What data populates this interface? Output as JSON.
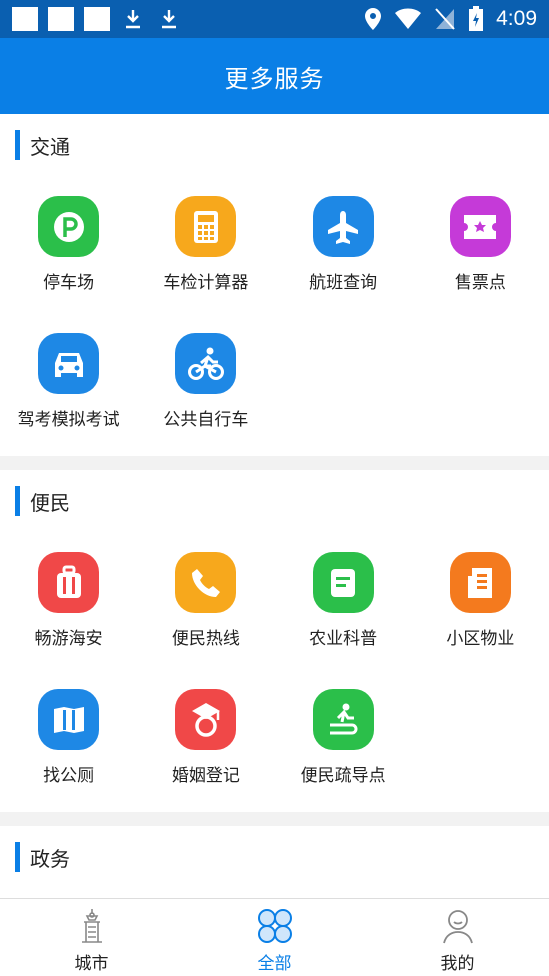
{
  "status_bar": {
    "time": "4:09"
  },
  "header": {
    "title": "更多服务"
  },
  "sections": [
    {
      "title": "交通",
      "items": [
        {
          "label": "停车场",
          "icon": "parking-icon",
          "color": "#2bbf4a"
        },
        {
          "label": "车检计算器",
          "icon": "calculator-icon",
          "color": "#f7a81c"
        },
        {
          "label": "航班查询",
          "icon": "airplane-icon",
          "color": "#1e88e5"
        },
        {
          "label": "售票点",
          "icon": "ticket-icon",
          "color": "#c53ad8"
        },
        {
          "label": "驾考模拟考试",
          "icon": "car-icon",
          "color": "#1e88e5"
        },
        {
          "label": "公共自行车",
          "icon": "bicycle-icon",
          "color": "#1e88e5"
        }
      ]
    },
    {
      "title": "便民",
      "items": [
        {
          "label": "畅游海安",
          "icon": "luggage-icon",
          "color": "#f04848"
        },
        {
          "label": "便民热线",
          "icon": "phone-icon",
          "color": "#f7a81c"
        },
        {
          "label": "农业科普",
          "icon": "document-icon",
          "color": "#2bbf4a"
        },
        {
          "label": "小区物业",
          "icon": "building-icon",
          "color": "#f47a1e"
        },
        {
          "label": "找公厕",
          "icon": "map-icon",
          "color": "#1e88e5"
        },
        {
          "label": "婚姻登记",
          "icon": "ring-icon",
          "color": "#f04848"
        },
        {
          "label": "便民疏导点",
          "icon": "guide-icon",
          "color": "#2bbf4a"
        }
      ]
    },
    {
      "title": "政务",
      "items": [
        {
          "color": "#f04848"
        },
        {
          "color": "#1e88e5"
        },
        {
          "color": "#1e88e5"
        },
        {
          "color": "#c53ad8"
        }
      ]
    }
  ],
  "tabs": [
    {
      "label": "城市",
      "icon": "city-tower-icon",
      "active": false
    },
    {
      "label": "全部",
      "icon": "grid-circles-icon",
      "active": true
    },
    {
      "label": "我的",
      "icon": "user-icon",
      "active": false
    }
  ],
  "colors": {
    "primary": "#0a7fe6",
    "status_bar": "#0a5fb0"
  }
}
